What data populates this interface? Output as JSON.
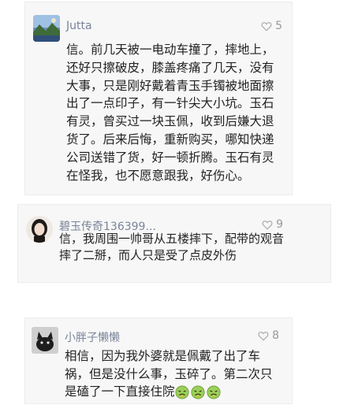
{
  "comments": [
    {
      "username": "Jutta",
      "likes": "5",
      "text": "信。前几天被一电动车撞了，摔地上，还好只擦破皮，膝盖疼痛了几天，没有大事，只是刚好戴着青玉手镯被地面擦出了一点印子，有一针尖大小坑。玉石有灵，曾买过一块玉佩，收到后嫌大退货了。后来后悔，重新购买，哪知快递公司送错了货，好一顿折腾。玉石有灵在怪我，也不愿意跟我，好伤心。"
    },
    {
      "username": "碧玉传奇136399...",
      "likes": "9",
      "text": "信，我周围一帅哥从五楼摔下，配带的观音摔了二掰，而人只是受了点皮外伤"
    },
    {
      "username": "小胖子懒懒",
      "likes": "8",
      "text": "相信，因为我外婆就是佩戴了出了车祸，但是没什么事，玉碎了。第二次只是磕了一下直接住院"
    }
  ],
  "icons": {
    "like": "heart-outline-icon",
    "emoji": "sick-face-emoji"
  },
  "colors": {
    "username": "#7a8499",
    "likes": "#999999",
    "text": "#222222",
    "card_bg": "#f7f7f7"
  }
}
